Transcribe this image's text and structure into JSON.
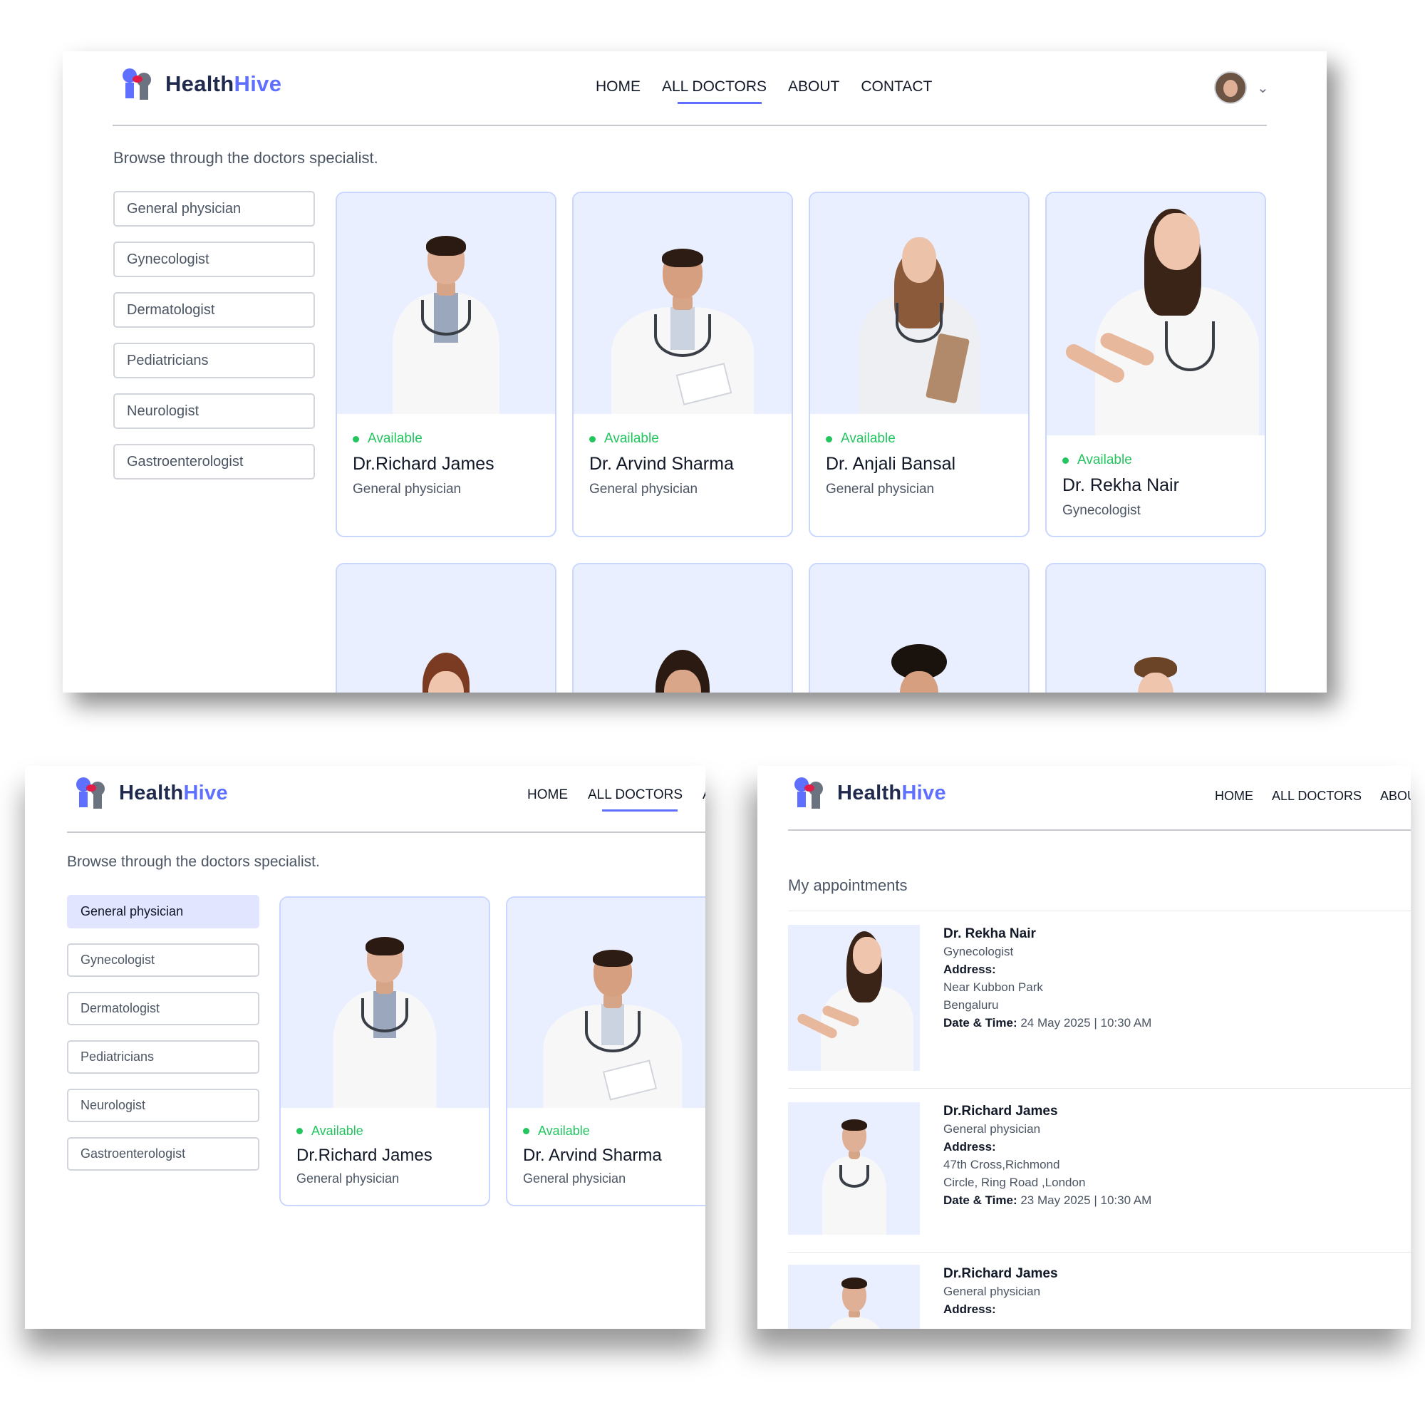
{
  "brand": {
    "name_part1": "Health",
    "name_part2": "Hive"
  },
  "nav": {
    "home": "HOME",
    "all_doctors": "ALL DOCTORS",
    "about": "ABOUT",
    "contact": "CONTACT",
    "about_cut_bl": "A",
    "about_cut_br": "ABOU"
  },
  "profile": {
    "chevron": "⌄"
  },
  "browse_text": "Browse through the doctors specialist.",
  "specialities": [
    "General physician",
    "Gynecologist",
    "Dermatologist",
    "Pediatricians",
    "Neurologist",
    "Gastroenterologist"
  ],
  "selected_speciality": "General physician",
  "doctors": [
    {
      "status": "Available",
      "name": "Dr.Richard James",
      "speciality": "General physician"
    },
    {
      "status": "Available",
      "name": "Dr. Arvind Sharma",
      "speciality": "General physician"
    },
    {
      "status": "Available",
      "name": "Dr. Anjali Bansal",
      "speciality": "General physician"
    },
    {
      "status": "Available",
      "name": "Dr. Rekha Nair",
      "speciality": "Gynecologist"
    }
  ],
  "appointments_title": "My appointments",
  "appointments": [
    {
      "name": "Dr. Rekha Nair",
      "speciality": "Gynecologist",
      "address_label": "Address:",
      "address_line1": "Near Kubbon Park",
      "address_line2": "Bengaluru",
      "datetime_label": "Date & Time:",
      "datetime": "24 May 2025 | 10:30 AM"
    },
    {
      "name": "Dr.Richard James",
      "speciality": "General physician",
      "address_label": "Address:",
      "address_line1": "47th Cross,Richmond",
      "address_line2": "Circle, Ring Road ,London",
      "datetime_label": "Date & Time:",
      "datetime": "23 May 2025 | 10:30 AM"
    },
    {
      "name": "Dr.Richard James",
      "speciality": "General physician",
      "address_label": "Address:"
    }
  ],
  "colors": {
    "accent": "#5f6fff",
    "available": "#22c55e",
    "card_bg": "#eaefff",
    "selected_bg": "#e2e5ff"
  }
}
